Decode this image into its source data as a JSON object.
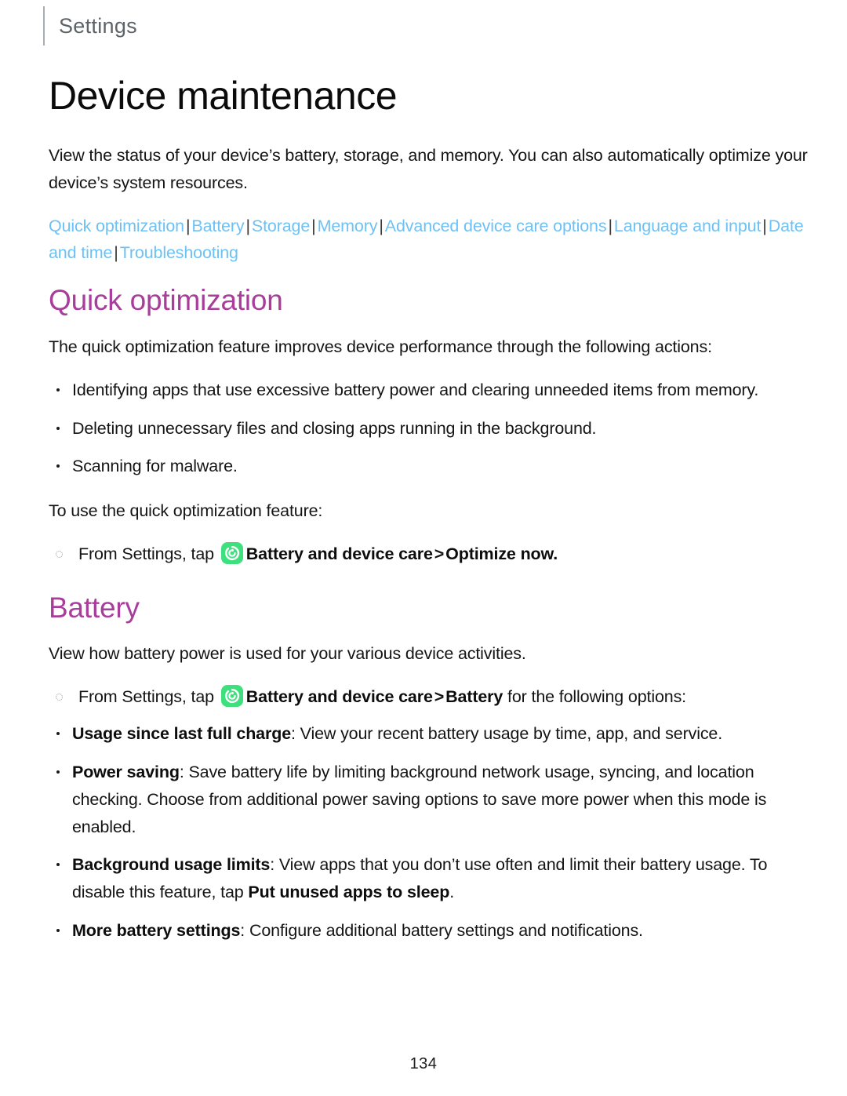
{
  "header": {
    "running_title": "Settings"
  },
  "page": {
    "title": "Device maintenance",
    "intro": "View the status of your device’s battery, storage, and memory. You can also automatically optimize your device’s system resources.",
    "page_number": "134"
  },
  "section_links": {
    "items": [
      "Quick optimization",
      "Battery",
      "Storage",
      "Memory",
      "Advanced device care options",
      "Language and input",
      "Date and time",
      "Troubleshooting"
    ],
    "separator": "|",
    "link_color": "#6ec1f5",
    "separator_color": "#3a3a3a"
  },
  "quick_optimization": {
    "heading": "Quick optimization",
    "heading_color": "#a93d9c",
    "intro": "The quick optimization feature improves device performance through the following actions:",
    "bullets": [
      "Identifying apps that use excessive battery power and clearing unneeded items from memory.",
      "Deleting unnecessary files and closing apps running in the background.",
      "Scanning for malware."
    ],
    "step_lead": "To use the quick optimization feature:",
    "step": {
      "prefix": "From Settings, tap",
      "icon_name": "battery-and-device-care-icon",
      "icon_color": "#3ee07d",
      "bold_path": "Battery and device care",
      "chevron": ">",
      "bold_target": "Optimize now.",
      "suffix": ""
    }
  },
  "battery": {
    "heading": "Battery",
    "heading_color": "#a93d9c",
    "intro": "View how battery power is used for your various device activities.",
    "step": {
      "prefix": "From Settings, tap",
      "icon_name": "battery-and-device-care-icon",
      "icon_color": "#3ee07d",
      "bold_path": "Battery and device care",
      "chevron": ">",
      "bold_target": "Battery",
      "suffix": "for the following options:"
    },
    "options": [
      {
        "term": "Usage since last full charge",
        "desc": ": View your recent battery usage by time, app, and service."
      },
      {
        "term": "Power saving",
        "desc": ": Save battery life by limiting background network usage, syncing, and location checking. Choose from additional power saving options to save more power when this mode is enabled."
      },
      {
        "term": "Background usage limits",
        "desc_before": ": View apps that you don’t use often and limit their battery usage. To disable this feature, tap ",
        "desc_bold": "Put unused apps to sleep",
        "desc_after": "."
      },
      {
        "term": "More battery settings",
        "desc": ": Configure additional battery settings and notifications."
      }
    ]
  }
}
